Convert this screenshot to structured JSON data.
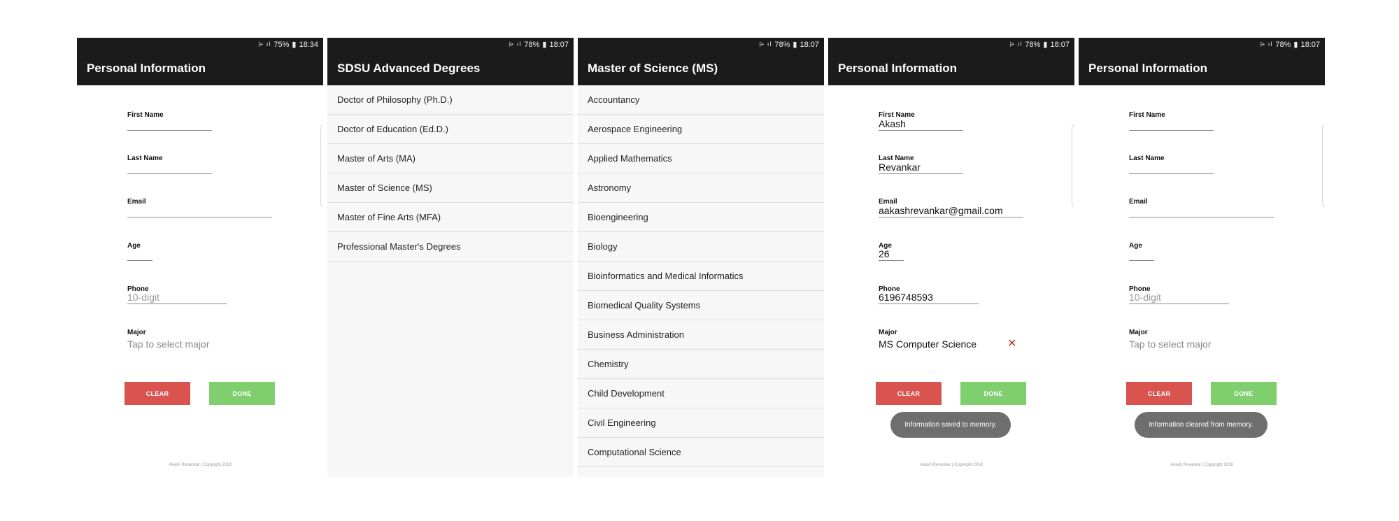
{
  "screens": [
    {
      "status": {
        "battery": "75%",
        "time": "18:34"
      },
      "title": "Personal Information",
      "fields": {
        "first_name": {
          "label": "First Name",
          "value": ""
        },
        "last_name": {
          "label": "Last Name",
          "value": ""
        },
        "email": {
          "label": "Email",
          "value": ""
        },
        "age": {
          "label": "Age",
          "value": ""
        },
        "phone": {
          "label": "Phone",
          "placeholder": "10-digit"
        },
        "major": {
          "label": "Major",
          "placeholder": "Tap to select major"
        }
      },
      "buttons": {
        "clear": "CLEAR",
        "done": "DONE"
      },
      "footer": "Akash Revankar | Copyright 2018"
    },
    {
      "status": {
        "battery": "78%",
        "time": "18:07"
      },
      "title": "SDSU Advanced Degrees",
      "items": [
        "Doctor of Philosophy (Ph.D.)",
        "Doctor of Education (Ed.D.)",
        "Master of Arts (MA)",
        "Master of Science (MS)",
        "Master of Fine Arts (MFA)",
        "Professional Master's Degrees"
      ]
    },
    {
      "status": {
        "battery": "78%",
        "time": "18:07"
      },
      "title": "Master of Science (MS)",
      "items": [
        "Accountancy",
        "Aerospace Engineering",
        "Applied Mathematics",
        "Astronomy",
        "Bioengineering",
        "Biology",
        "Bioinformatics and Medical Informatics",
        "Biomedical Quality Systems",
        "Business Administration",
        "Chemistry",
        "Child Development",
        "Civil Engineering",
        "Computational Science"
      ]
    },
    {
      "status": {
        "battery": "78%",
        "time": "18:07"
      },
      "title": "Personal Information",
      "fields": {
        "first_name": {
          "label": "First Name",
          "value": "Akash"
        },
        "last_name": {
          "label": "Last Name",
          "value": "Revankar"
        },
        "email": {
          "label": "Email",
          "value": "aakashrevankar@gmail.com"
        },
        "age": {
          "label": "Age",
          "value": "26"
        },
        "phone": {
          "label": "Phone",
          "value": "6196748593"
        },
        "major": {
          "label": "Major",
          "value": "MS Computer Science",
          "clear_glyph": "✕"
        }
      },
      "buttons": {
        "clear": "CLEAR",
        "done": "DONE"
      },
      "toast": "Information saved to memory.",
      "footer": "Akash Revankar | Copyright 2018"
    },
    {
      "status": {
        "battery": "78%",
        "time": "18:07"
      },
      "title": "Personal Information",
      "fields": {
        "first_name": {
          "label": "First Name",
          "value": ""
        },
        "last_name": {
          "label": "Last Name",
          "value": ""
        },
        "email": {
          "label": "Email",
          "value": ""
        },
        "age": {
          "label": "Age",
          "value": ""
        },
        "phone": {
          "label": "Phone",
          "placeholder": "10-digit"
        },
        "major": {
          "label": "Major",
          "placeholder": "Tap to select major"
        }
      },
      "buttons": {
        "clear": "CLEAR",
        "done": "DONE"
      },
      "toast": "Information cleared from memory.",
      "footer": "Akash Revankar | Copyright 2018"
    }
  ],
  "colors": {
    "appbar": "#1b1b1b",
    "clear_button": "#d9534f",
    "done_button": "#7fcf6e",
    "toast": "#6e6e6e",
    "list_bg": "#f7f7f7"
  },
  "icons": {
    "status": "wifi-signal-battery-icons",
    "clear_major": "close-icon"
  }
}
